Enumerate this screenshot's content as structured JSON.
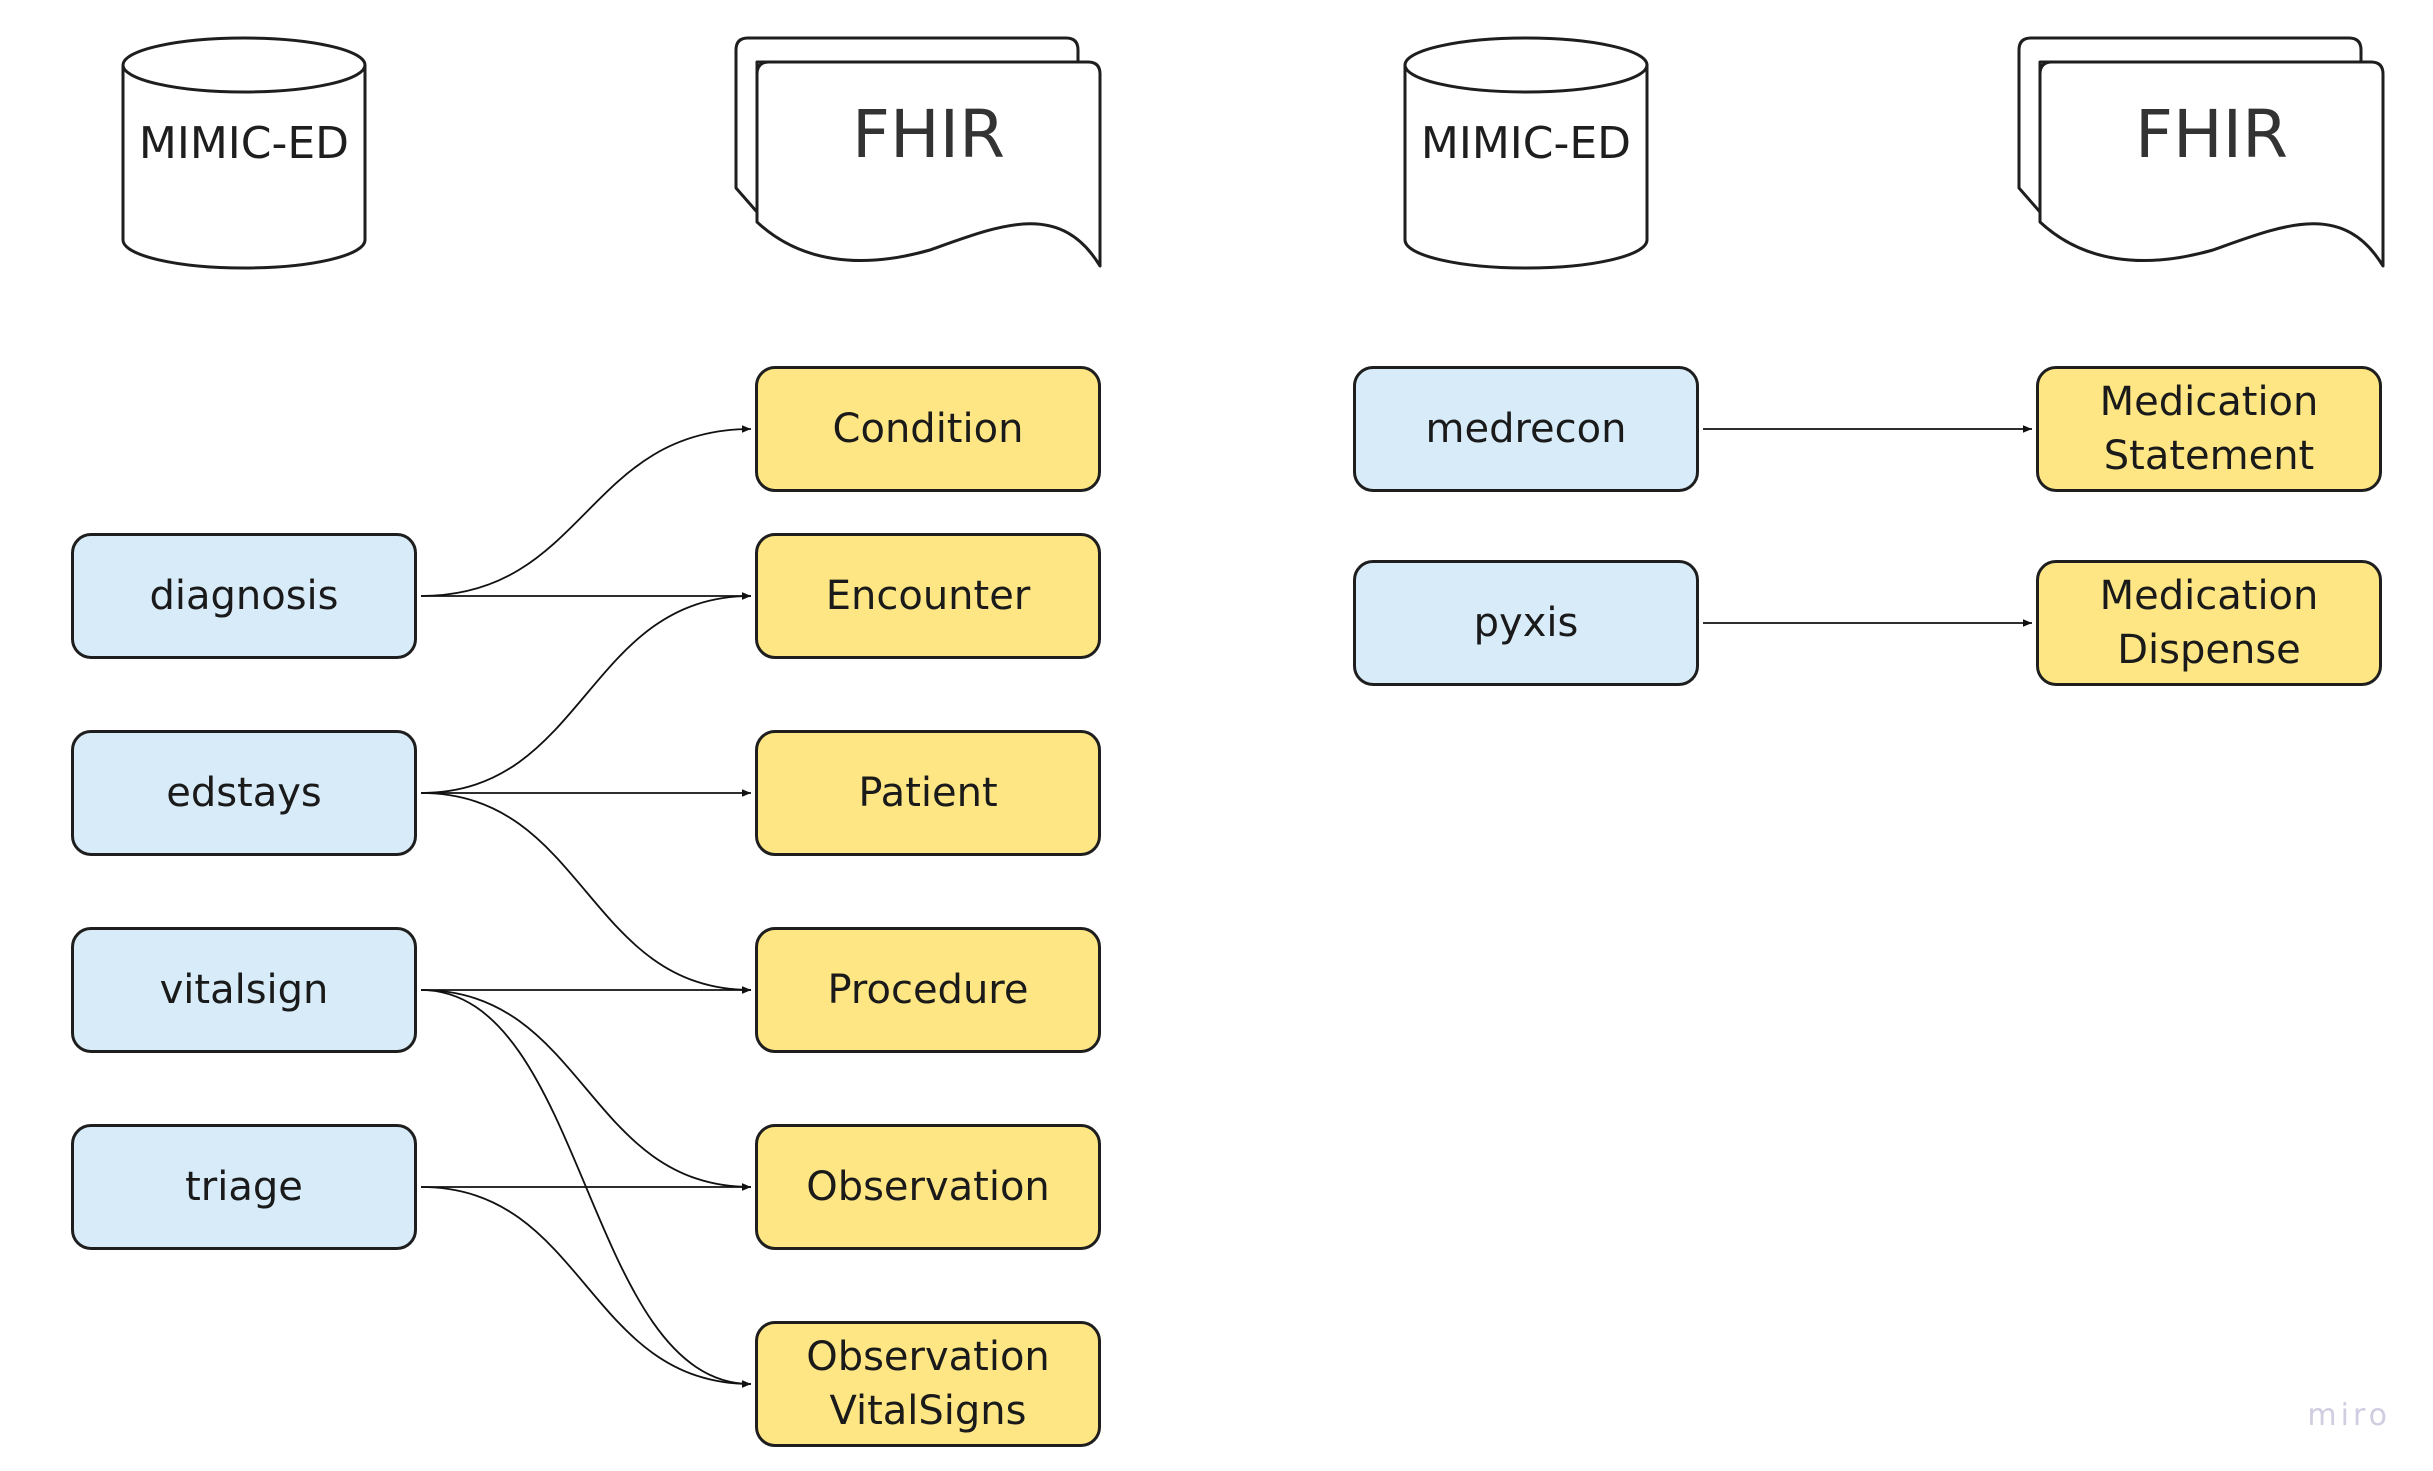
{
  "diagram": {
    "left_panel": {
      "source_header": {
        "label": "MIMIC-ED",
        "icon": "database-cylinder-icon"
      },
      "target_header": {
        "label": "FHIR",
        "icon": "multi-document-icon"
      },
      "sources": [
        {
          "id": "diagnosis",
          "label": "diagnosis"
        },
        {
          "id": "edstays",
          "label": "edstays"
        },
        {
          "id": "vitalsign",
          "label": "vitalsign"
        },
        {
          "id": "triage",
          "label": "triage"
        }
      ],
      "targets": [
        {
          "id": "condition",
          "label": "Condition"
        },
        {
          "id": "encounter",
          "label": "Encounter"
        },
        {
          "id": "patient",
          "label": "Patient"
        },
        {
          "id": "procedure",
          "label": "Procedure"
        },
        {
          "id": "observation",
          "label": "Observation"
        },
        {
          "id": "observation_vitalsigns",
          "label": "Observation\nVitalSigns"
        }
      ],
      "edges": [
        {
          "from": "diagnosis",
          "to": "condition"
        },
        {
          "from": "diagnosis",
          "to": "encounter"
        },
        {
          "from": "edstays",
          "to": "encounter"
        },
        {
          "from": "edstays",
          "to": "patient"
        },
        {
          "from": "edstays",
          "to": "procedure"
        },
        {
          "from": "vitalsign",
          "to": "procedure"
        },
        {
          "from": "vitalsign",
          "to": "observation"
        },
        {
          "from": "vitalsign",
          "to": "observation_vitalsigns"
        },
        {
          "from": "triage",
          "to": "observation"
        },
        {
          "from": "triage",
          "to": "observation_vitalsigns"
        }
      ]
    },
    "right_panel": {
      "source_header": {
        "label": "MIMIC-ED",
        "icon": "database-cylinder-icon"
      },
      "target_header": {
        "label": "FHIR",
        "icon": "multi-document-icon"
      },
      "sources": [
        {
          "id": "medrecon",
          "label": "medrecon"
        },
        {
          "id": "pyxis",
          "label": "pyxis"
        }
      ],
      "targets": [
        {
          "id": "medication_statement",
          "label": "Medication\nStatement"
        },
        {
          "id": "medication_dispense",
          "label": "Medication\nDispense"
        }
      ],
      "edges": [
        {
          "from": "medrecon",
          "to": "medication_statement"
        },
        {
          "from": "pyxis",
          "to": "medication_dispense"
        }
      ]
    },
    "colors": {
      "source_fill": "#d7ebf8",
      "target_fill": "#fde683",
      "stroke": "#1e1e1e"
    },
    "watermark": "miro"
  }
}
